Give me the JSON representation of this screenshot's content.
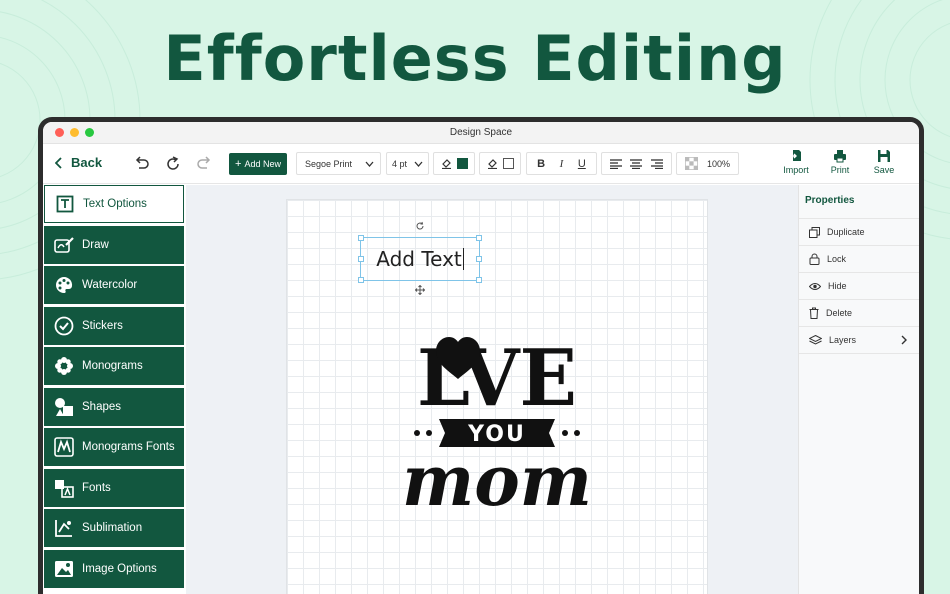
{
  "headline": "Effortless Editing",
  "window": {
    "title": "Design Space",
    "traffic_lights": [
      "#ff5f57",
      "#febc2e",
      "#28c840"
    ]
  },
  "toolbar": {
    "back_label": "Back",
    "add_new_label": "Add New",
    "font_value": "Segoe Print",
    "size_value": "4 pt",
    "text_color": "#12573f",
    "fill_color": "#ffffff",
    "bold_label": "B",
    "italic_label": "I",
    "underline_label": "U",
    "opacity_value": "100%",
    "import_label": "Import",
    "print_label": "Print",
    "save_label": "Save"
  },
  "sidebar": {
    "items": [
      {
        "label": "Text Options",
        "icon": "text-box-icon",
        "active": true
      },
      {
        "label": "Draw",
        "icon": "draw-icon"
      },
      {
        "label": "Watercolor",
        "icon": "palette-icon"
      },
      {
        "label": "Stickers",
        "icon": "sticker-check-icon"
      },
      {
        "label": "Monograms",
        "icon": "flower-icon"
      },
      {
        "label": "Shapes",
        "icon": "shapes-icon"
      },
      {
        "label": "Monograms Fonts",
        "icon": "monogram-font-icon"
      },
      {
        "label": "Fonts",
        "icon": "font-icon"
      },
      {
        "label": "Sublimation",
        "icon": "sublimation-icon"
      },
      {
        "label": "Image Options",
        "icon": "image-icon"
      }
    ]
  },
  "canvas": {
    "text_box_value": "Add Text",
    "artwork": {
      "line1": "LVE",
      "line2": "YOU",
      "line3": "mom"
    }
  },
  "properties": {
    "title": "Properties",
    "items": [
      {
        "label": "Duplicate",
        "icon": "duplicate-icon"
      },
      {
        "label": "Lock",
        "icon": "lock-icon"
      },
      {
        "label": "Hide",
        "icon": "eye-icon"
      },
      {
        "label": "Delete",
        "icon": "trash-icon"
      },
      {
        "label": "Layers",
        "icon": "layers-icon"
      }
    ]
  },
  "colors": {
    "brand": "#12573f",
    "background": "#d8f5e6"
  }
}
